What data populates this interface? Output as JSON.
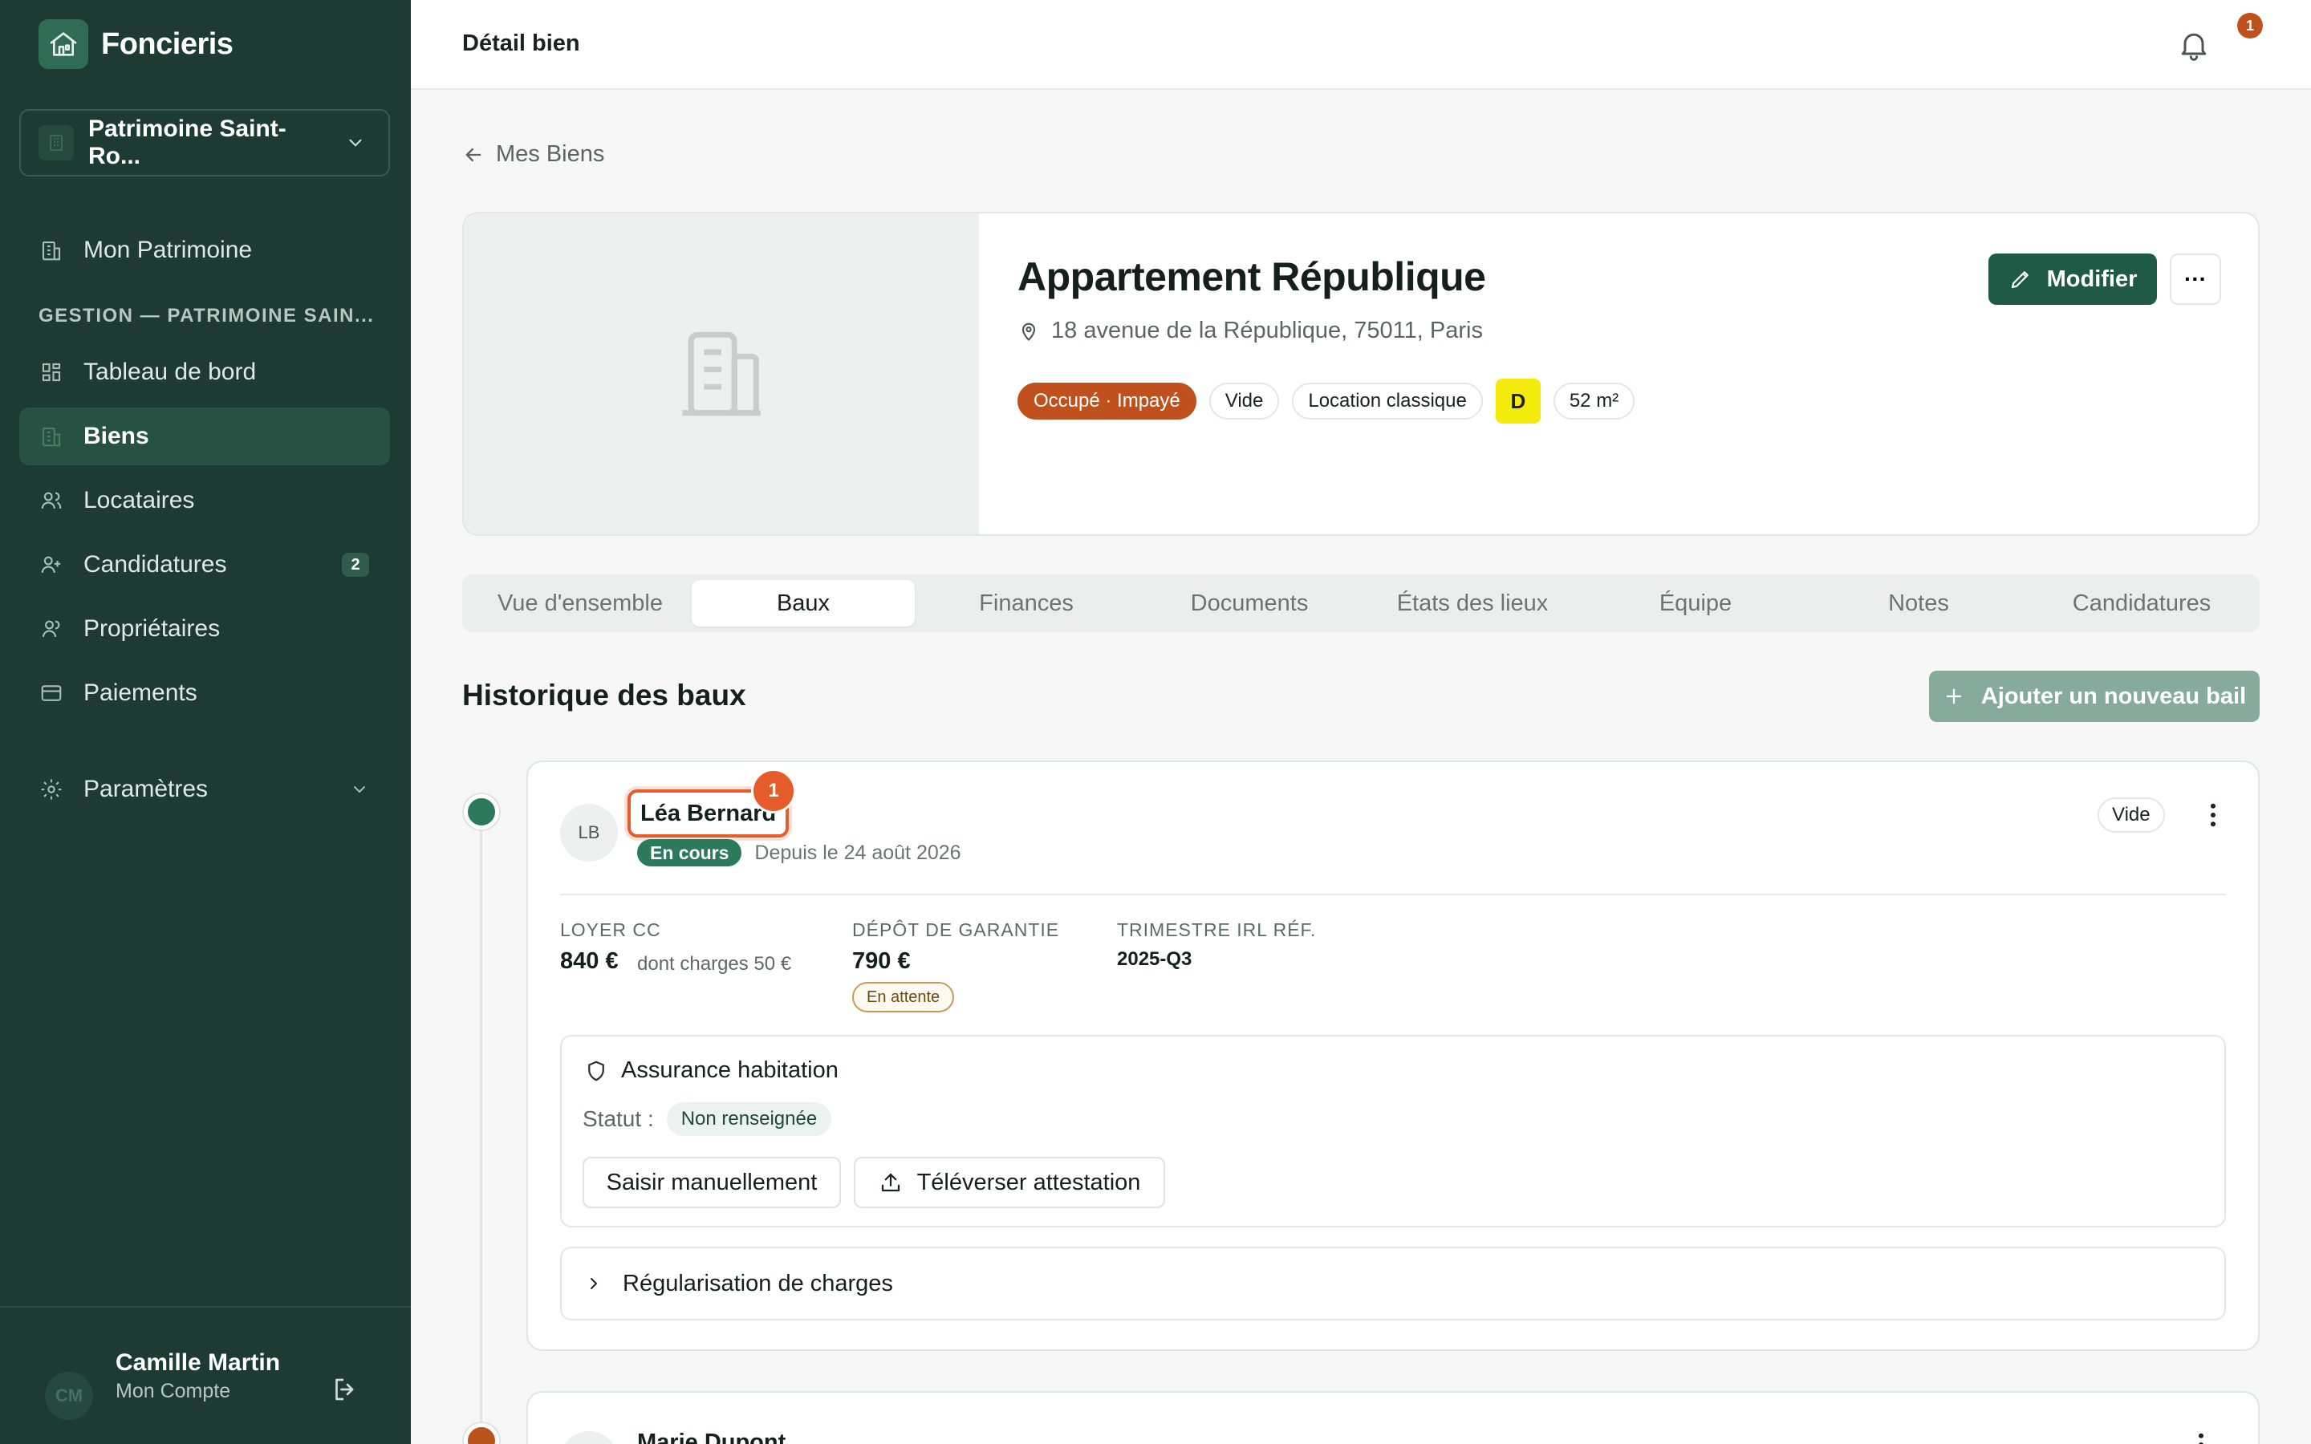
{
  "app": {
    "name": "Foncieris"
  },
  "sidebar": {
    "patrimoine_select": "Patrimoine Saint-Ro...",
    "top_item": "Mon Patrimoine",
    "section_label": "GESTION — PATRIMOINE SAIN...",
    "items": [
      {
        "label": "Tableau de bord",
        "icon": "dashboard-icon"
      },
      {
        "label": "Biens",
        "icon": "building-icon",
        "active": true
      },
      {
        "label": "Locataires",
        "icon": "users-icon"
      },
      {
        "label": "Candidatures",
        "icon": "user-plus-icon",
        "badge": "2"
      },
      {
        "label": "Propriétaires",
        "icon": "owners-icon"
      },
      {
        "label": "Paiements",
        "icon": "card-icon"
      }
    ],
    "settings": "Paramètres",
    "user": {
      "initials": "CM",
      "name": "Camille Martin",
      "subtitle": "Mon Compte"
    }
  },
  "topbar": {
    "title": "Détail bien",
    "notifications": "1"
  },
  "back_link": "Mes Biens",
  "property": {
    "title": "Appartement République",
    "address": "18 avenue de la République, 75011, Paris",
    "tags": {
      "status": "Occupé · Impayé",
      "furnishing": "Vide",
      "lease_type": "Location classique",
      "dpe": "D",
      "surface": "52 m²"
    },
    "edit_label": "Modifier",
    "more_label": "···"
  },
  "tabs": [
    "Vue d'ensemble",
    "Baux",
    "Finances",
    "Documents",
    "États des lieux",
    "Équipe",
    "Notes",
    "Candidatures"
  ],
  "active_tab": "Baux",
  "leases": {
    "title": "Historique des baux",
    "add_label": "Ajouter un nouveau bail",
    "current": {
      "initials": "LB",
      "tenant": "Léa Bernard",
      "step": "1",
      "status": "En cours",
      "since": "Depuis le 24 août 2026",
      "furnishing": "Vide",
      "rent_label": "LOYER CC",
      "rent_value": "840 €",
      "rent_sub": "dont charges 50 €",
      "deposit_label": "DÉPÔT DE GARANTIE",
      "deposit_value": "790 €",
      "deposit_status": "En attente",
      "irl_label": "TRIMESTRE IRL RÉF.",
      "irl_value": "2025-Q3",
      "insurance": {
        "title": "Assurance habitation",
        "status_label": "Statut :",
        "status_value": "Non renseignée",
        "manual_button": "Saisir manuellement",
        "upload_button": "Téléverser attestation"
      },
      "regularisation": "Régularisation de charges"
    },
    "previous": {
      "tenant": "Marie Dupont"
    }
  },
  "colors": {
    "sidebar_bg": "#1d3b32",
    "primary": "#1f5a47",
    "status_unpaid": "#c0511d",
    "dpe_d": "#f4ea0c",
    "highlight": "#e65c2a"
  }
}
